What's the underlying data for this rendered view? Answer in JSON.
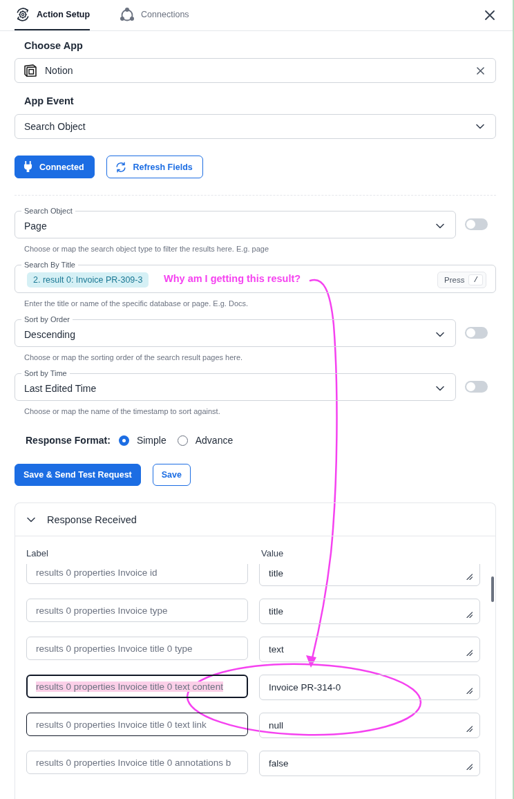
{
  "tabs": [
    {
      "label": "Action Setup",
      "selected": true
    },
    {
      "label": "Connections",
      "selected": false
    }
  ],
  "choose_app": {
    "heading": "Choose App",
    "value": "Notion"
  },
  "app_event": {
    "heading": "App Event",
    "value": "Search Object"
  },
  "connection_buttons": [
    {
      "label": "Connected",
      "kind": "primary"
    },
    {
      "label": "Refresh Fields",
      "kind": "outline"
    }
  ],
  "fields": [
    {
      "kind": "select",
      "label": "Search Object",
      "value": "Page",
      "toggle_on": false,
      "help": "Choose or map the search object type to filter the results here. E.g. page"
    },
    {
      "kind": "mapped",
      "label": "Search By Title",
      "chip": "2. result 0: Invoice PR-309-3",
      "shortcut": "Press",
      "key": "/",
      "help": "Enter the title or name of the specific database or page. E.g. Docs."
    },
    {
      "kind": "select",
      "label": "Sort by Order",
      "value": "Descending",
      "toggle_on": false,
      "help": "Choose or map the sorting order of the search result pages here."
    },
    {
      "kind": "select",
      "label": "Sort by Time",
      "value": "Last Edited Time",
      "toggle_on": false,
      "help": "Choose or map the name of the timestamp to sort against."
    }
  ],
  "response_format": {
    "label": "Response Format:",
    "options": [
      {
        "label": "Simple",
        "selected": true
      },
      {
        "label": "Advance",
        "selected": false
      }
    ]
  },
  "action_buttons": [
    {
      "label": "Save & Send Test Request",
      "kind": "primary"
    },
    {
      "label": "Save",
      "kind": "outline"
    }
  ],
  "response_panel": {
    "title": "Response Received",
    "expanded": true,
    "columns": [
      "Label",
      "Value"
    ],
    "rows": [
      {
        "label": "results 0 properties Invoice id",
        "value": "title",
        "focused": false,
        "hovered": false,
        "highlighted": false
      },
      {
        "label": "results 0 properties Invoice type",
        "value": "title",
        "focused": false,
        "hovered": false,
        "highlighted": false
      },
      {
        "label": "results 0 properties Invoice title 0 type",
        "value": "text",
        "focused": false,
        "hovered": false,
        "highlighted": false
      },
      {
        "label": "results 0 properties Invoice title 0 text content",
        "value": "Invoice PR-314-0",
        "focused": true,
        "hovered": false,
        "highlighted": true
      },
      {
        "label": "results 0 properties Invoice title 0 text link",
        "value": "null",
        "focused": false,
        "hovered": true,
        "highlighted": false
      },
      {
        "label": "results 0 properties Invoice title 0 annotations b",
        "value": "false",
        "focused": false,
        "hovered": false,
        "highlighted": false
      }
    ]
  },
  "annotation": {
    "text": "Why am I getting this result?"
  }
}
